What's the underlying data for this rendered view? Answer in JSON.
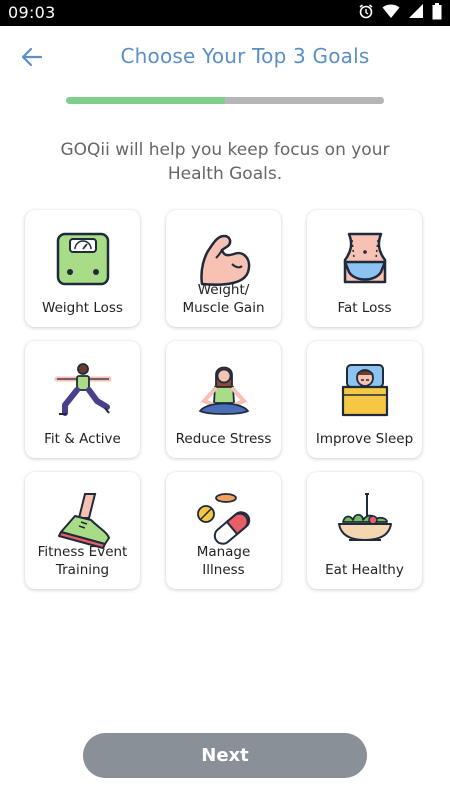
{
  "status_bar": {
    "time": "09:03",
    "icons": [
      "alarm-icon",
      "wifi-icon",
      "signal-icon",
      "battery-icon"
    ]
  },
  "header": {
    "back_icon": "arrow-left-icon",
    "title": "Choose Your Top 3 Goals"
  },
  "progress": {
    "fraction": 0.5,
    "fill_color": "#7fcf8a",
    "track_color": "#b6b6b6"
  },
  "subtitle": "GOQii will help you keep focus on your Health Goals.",
  "goals": [
    {
      "label": "Weight Loss",
      "icon": "scale-icon"
    },
    {
      "label": "Weight/\nMuscle Gain",
      "icon": "flexed-bicep-icon"
    },
    {
      "label": "Fat Loss",
      "icon": "waist-icon"
    },
    {
      "label": "Fit & Active",
      "icon": "yoga-pose-icon"
    },
    {
      "label": "Reduce Stress",
      "icon": "meditation-icon"
    },
    {
      "label": "Improve Sleep",
      "icon": "sleeping-person-icon"
    },
    {
      "label": "Fitness Event\nTraining",
      "icon": "running-shoe-icon"
    },
    {
      "label": "Manage\nIllness",
      "icon": "pills-icon"
    },
    {
      "label": "Eat Healthy",
      "icon": "salad-bowl-icon"
    }
  ],
  "next_button": {
    "label": "Next",
    "color": "#8a9097"
  },
  "colors": {
    "accent": "#5b8fc6"
  }
}
